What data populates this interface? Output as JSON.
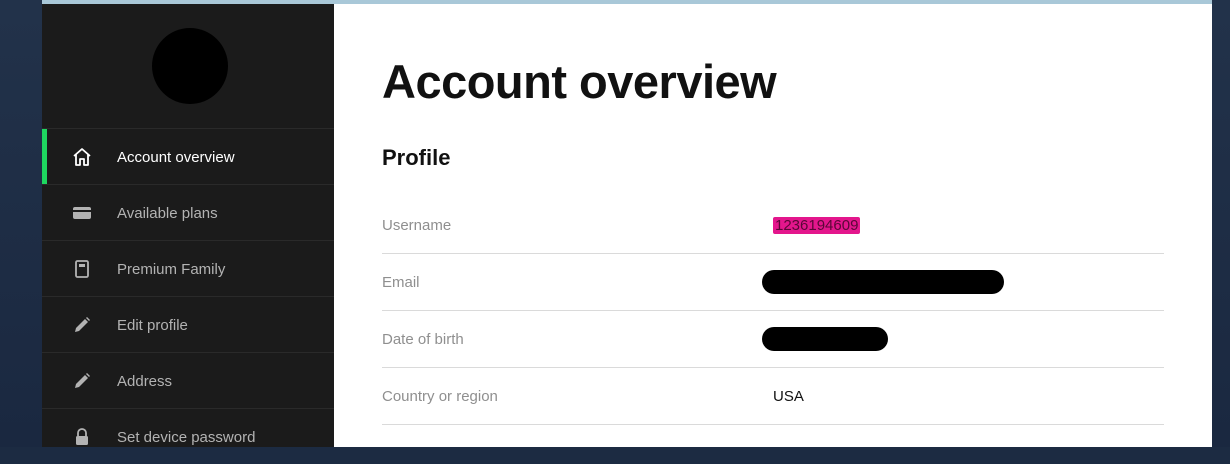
{
  "sidebar": {
    "items": [
      {
        "label": "Account overview",
        "icon": "home-icon",
        "active": true
      },
      {
        "label": "Available plans",
        "icon": "credit-card-icon"
      },
      {
        "label": "Premium Family",
        "icon": "clipboard-icon"
      },
      {
        "label": "Edit profile",
        "icon": "pencil-icon"
      },
      {
        "label": "Address",
        "icon": "pencil-icon"
      },
      {
        "label": "Set device password",
        "icon": "lock-icon"
      }
    ],
    "accent_color": "#1ed760"
  },
  "main": {
    "title": "Account overview",
    "profile": {
      "heading": "Profile",
      "rows": [
        {
          "label": "Username",
          "value": "1236194609"
        },
        {
          "label": "Email",
          "value": ""
        },
        {
          "label": "Date of birth",
          "value": ""
        },
        {
          "label": "Country or region",
          "value": "USA"
        }
      ]
    }
  }
}
